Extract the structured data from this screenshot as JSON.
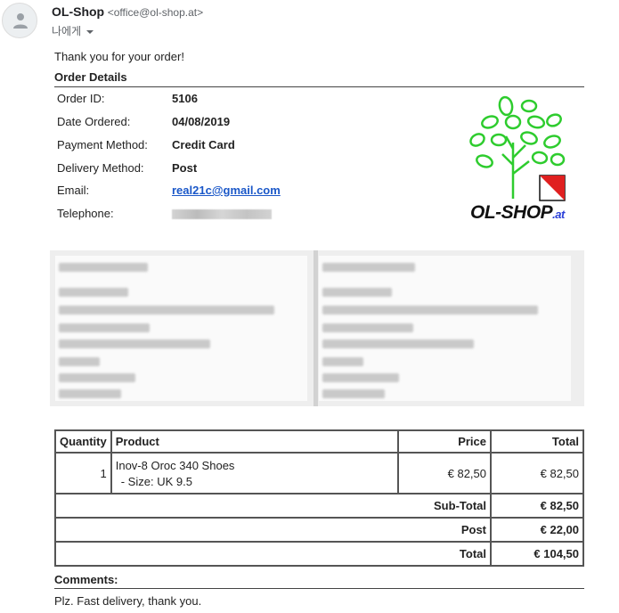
{
  "header": {
    "sender_name": "OL-Shop",
    "sender_email": "<office@ol-shop.at>",
    "recipient": "나에게"
  },
  "message": {
    "thanks": "Thank you for your order!",
    "order_details_title": "Order Details",
    "details": [
      {
        "label": "Order ID:",
        "value": "5106"
      },
      {
        "label": "Date Ordered:",
        "value": "04/08/2019"
      },
      {
        "label": "Payment Method:",
        "value": "Credit Card"
      },
      {
        "label": "Delivery Method:",
        "value": "Post"
      },
      {
        "label": "Email:",
        "value": "real21c@gmail.com"
      },
      {
        "label": "Telephone:",
        "value": ""
      }
    ]
  },
  "logo": {
    "main": "OL-SHOP",
    "suffix": ".at",
    "leaf_color": "#2ecc2e",
    "accent_color": "#e02020"
  },
  "order_table": {
    "headers": {
      "quantity": "Quantity",
      "product": "Product",
      "price": "Price",
      "total": "Total"
    },
    "items": [
      {
        "quantity": "1",
        "product": "Inov-8 Oroc 340 Shoes",
        "option": "-  Size: UK 9.5",
        "price": "€ 82,50",
        "total": "€ 82,50"
      }
    ],
    "totals": [
      {
        "label": "Sub-Total",
        "value": "€ 82,50"
      },
      {
        "label": "Post",
        "value": "€ 22,00"
      },
      {
        "label": "Total",
        "value": "€ 104,50"
      }
    ]
  },
  "comments": {
    "title": "Comments:",
    "text": "Plz. Fast delivery, thank you."
  },
  "colors": {
    "link": "#1a57c8",
    "rule": "#444444"
  }
}
